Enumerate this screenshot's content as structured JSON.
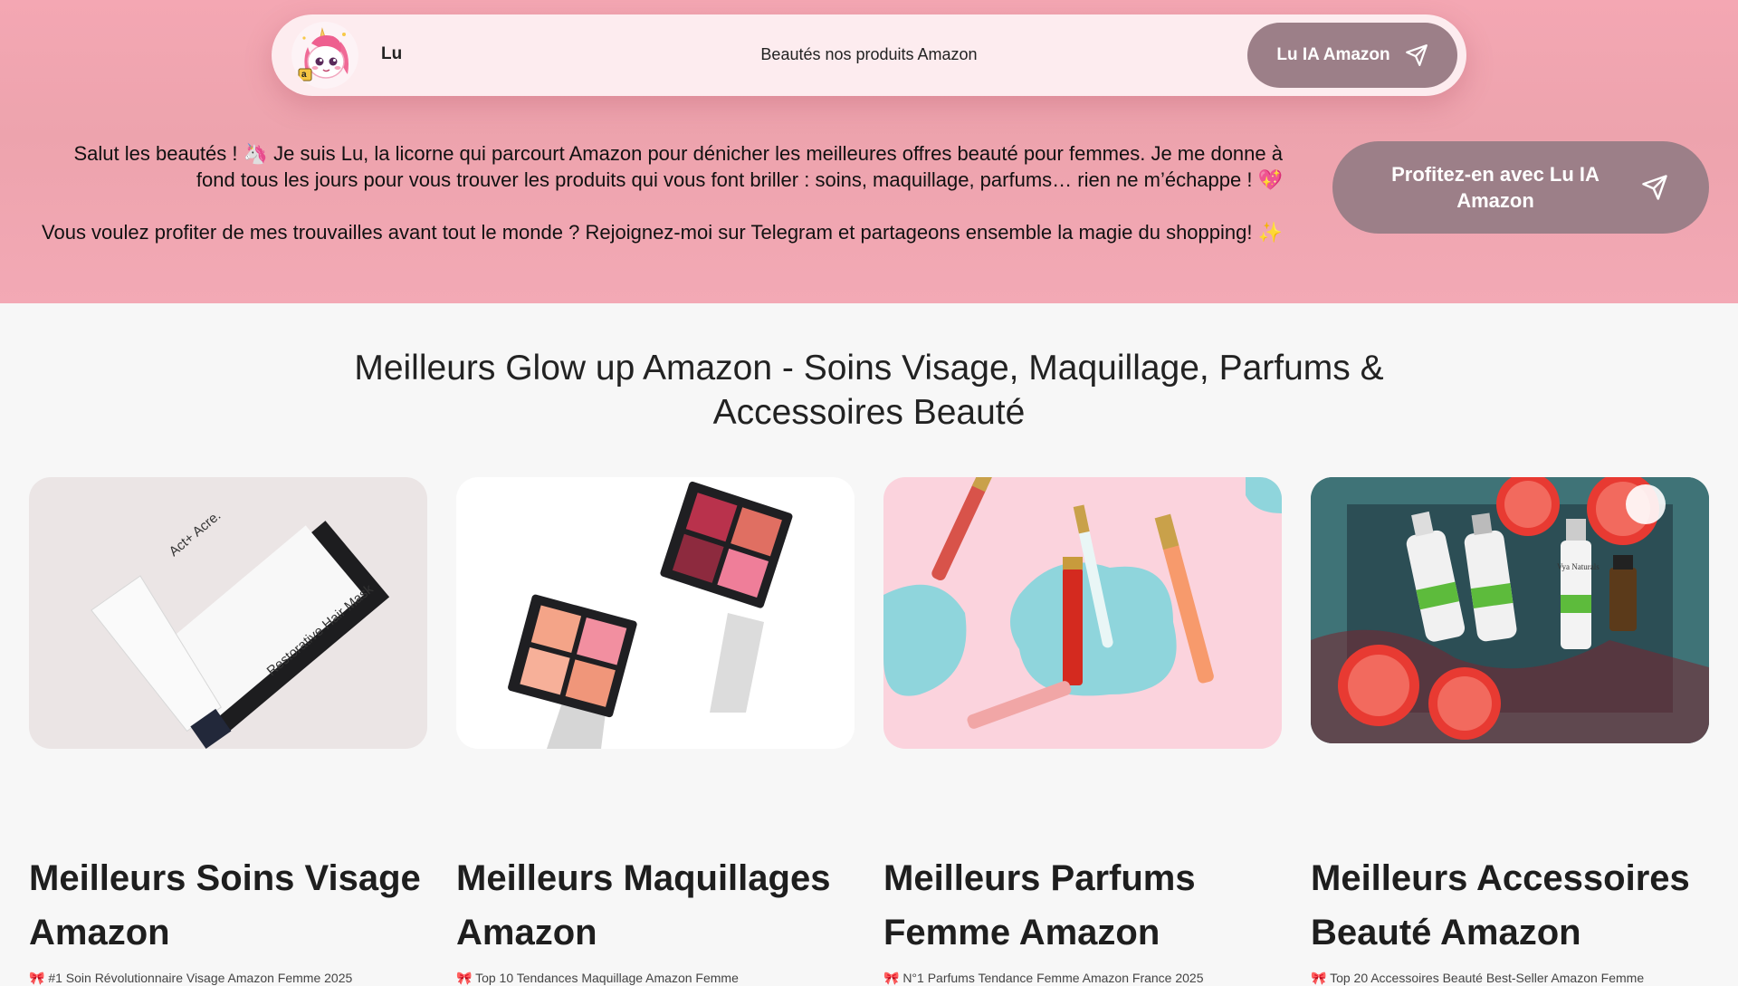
{
  "header": {
    "brand": "Lu",
    "tagline": "Beautés nos produits Amazon",
    "cta_label": "Lu IA Amazon",
    "cta_icon": "paper-plane-icon",
    "logo_icon": "unicorn-mascot-icon",
    "logo_badge": "a"
  },
  "hero": {
    "paragraph_1": "Salut les beautés ! 🦄 Je suis Lu, la licorne qui parcourt Amazon pour dénicher les meilleures offres beauté pour femmes. Je me donne à fond tous les jours pour vous trouver les produits qui vous font briller : soins, maquillage, parfums… rien ne m’échappe ! 💖",
    "paragraph_2": "Vous voulez profiter de mes trouvailles avant tout le monde ? Rejoignez-moi sur Telegram et partageons ensemble la magie du shopping! ✨",
    "cta_label": "Profitez-en avec Lu IA Amazon",
    "cta_icon": "paper-plane-icon"
  },
  "section": {
    "title": "Meilleurs Glow up Amazon - Soins Visage, Maquillage, Parfums & Accessoires Beauté"
  },
  "categories": [
    {
      "title": "Meilleurs Soins Visage Amazon",
      "image": "skincare-hair-mask-photo",
      "product_text_1": "Act+ Acre.",
      "product_text_2": "Restorative Hair Mask",
      "teaser": "🎀 #1 Soin Révolutionnaire Visage Amazon Femme 2025"
    },
    {
      "title": "Meilleurs Maquillages Amazon",
      "image": "blush-palettes-photo",
      "teaser": "🎀 Top 10 Tendances Maquillage Amazon Femme"
    },
    {
      "title": "Meilleurs Parfums Femme Amazon",
      "image": "lipgloss-photo",
      "teaser": "🎀 N°1 Parfums Tendance Femme Amazon France 2025"
    },
    {
      "title": "Meilleurs Accessoires Beauté Amazon",
      "image": "serum-bottles-grapefruit-photo",
      "product_brand": "Vya Naturals",
      "teaser": "🎀 Top 20 Accessoires Beauté Best-Seller Amazon Femme"
    }
  ],
  "colors": {
    "hero_pink": "#f4a7b3",
    "button_mauve": "#9c7f88",
    "topbar_bg": "#fdecef",
    "page_bg": "#f7f7f7"
  }
}
